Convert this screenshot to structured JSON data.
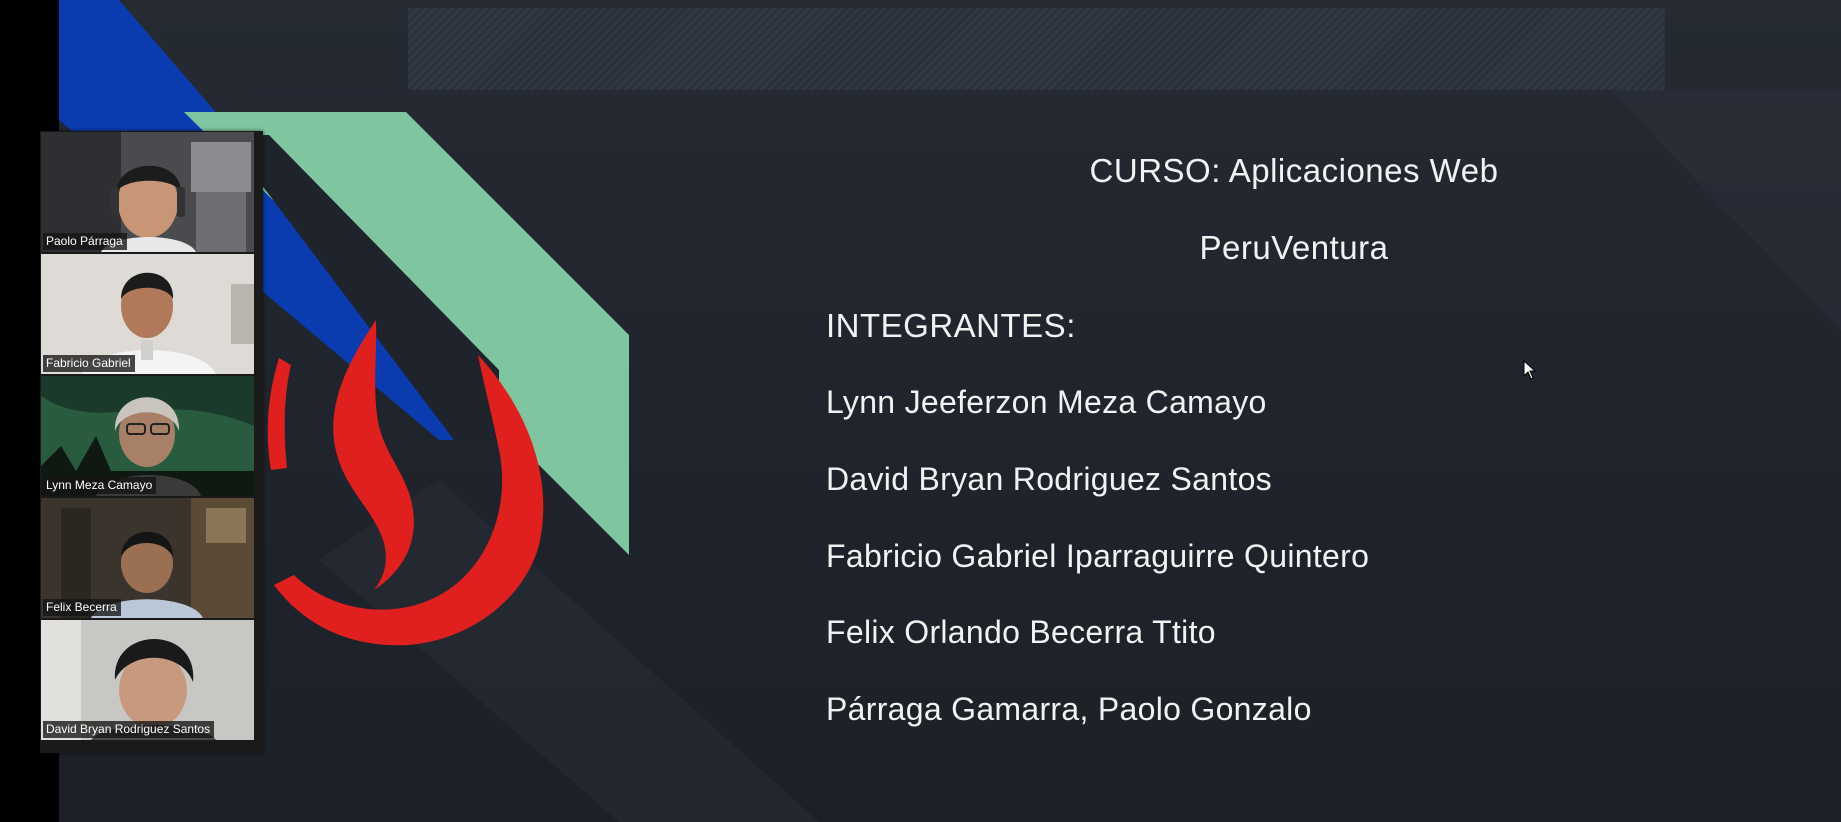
{
  "slide": {
    "course_title": "CURSO: Aplicaciones Web",
    "project_name": "PeruVentura",
    "members_heading": "INTEGRANTES:",
    "members": [
      "Lynn Jeeferzon Meza Camayo",
      "David Bryan Rodriguez Santos",
      "Fabricio Gabriel Iparraguirre Quintero",
      "Felix Orlando Becerra Ttito",
      "Párraga Gamarra, Paolo Gonzalo"
    ]
  },
  "gallery": {
    "participants": [
      {
        "name": "Paolo Párraga"
      },
      {
        "name": "Fabricio Gabriel"
      },
      {
        "name": "Lynn Meza Camayo"
      },
      {
        "name": "Felix Becerra"
      },
      {
        "name": "David Bryan Rodriguez Santos"
      }
    ]
  },
  "colors": {
    "logo_red": "#e0201f",
    "stripe_blue": "#0a3cb0",
    "stripe_mint": "#7fc6a0",
    "text": "#f2f2f2"
  }
}
